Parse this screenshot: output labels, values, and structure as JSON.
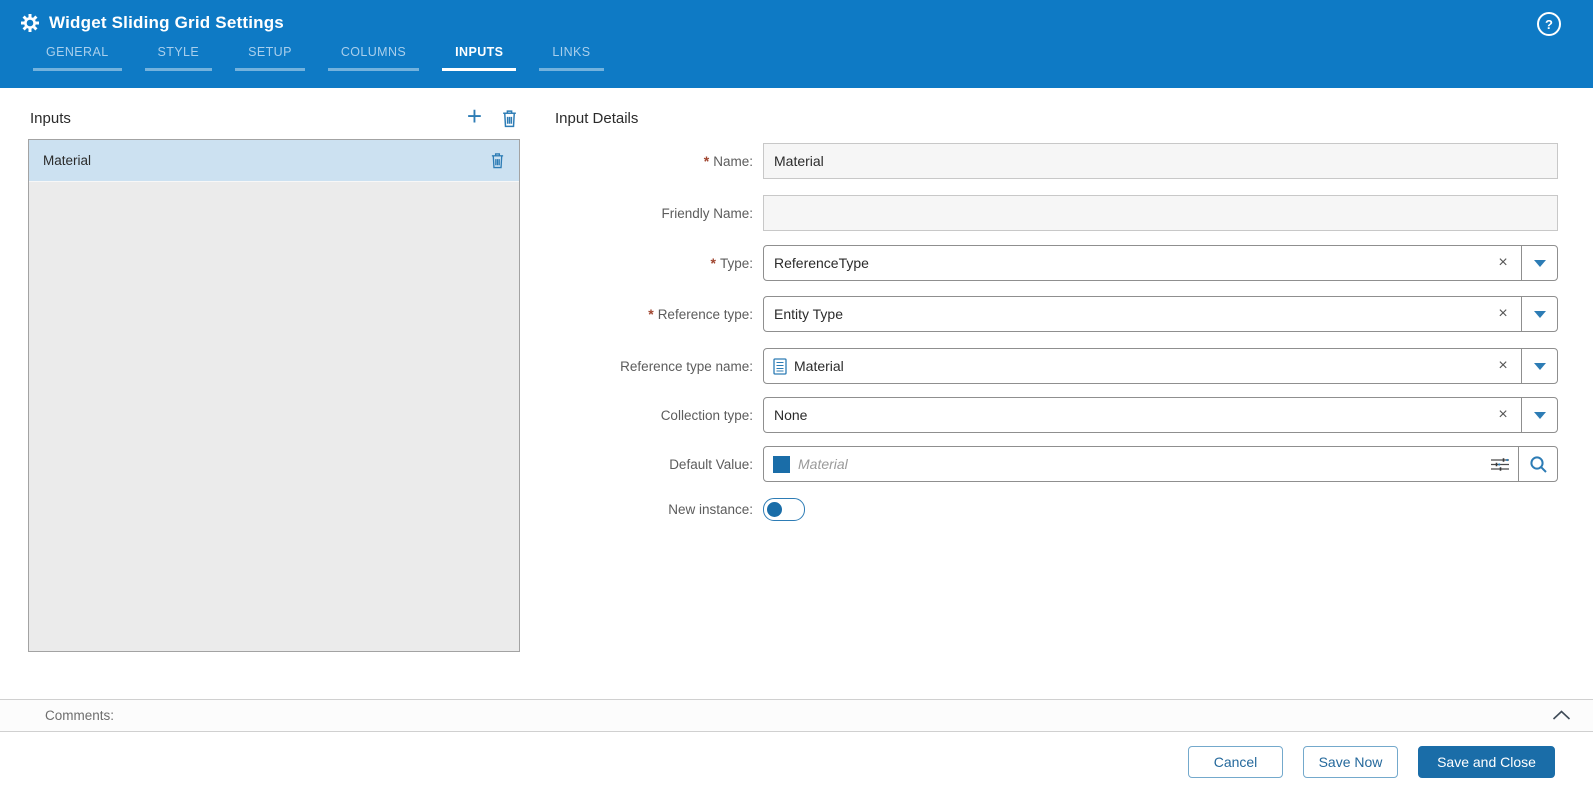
{
  "header": {
    "title": "Widget Sliding Grid Settings",
    "help_glyph": "?",
    "tabs": [
      {
        "label": "GENERAL",
        "active": false
      },
      {
        "label": "STYLE",
        "active": false
      },
      {
        "label": "SETUP",
        "active": false
      },
      {
        "label": "COLUMNS",
        "active": false
      },
      {
        "label": "INPUTS",
        "active": true
      },
      {
        "label": "LINKS",
        "active": false
      }
    ]
  },
  "inputs_panel": {
    "title": "Inputs",
    "add_glyph": "+",
    "items": [
      {
        "label": "Material",
        "selected": true
      }
    ]
  },
  "details": {
    "title": "Input Details",
    "required_mark": "*",
    "combo_clear_glyph": "×",
    "fields": [
      {
        "label": "Name:",
        "required": true,
        "widget": "text",
        "value": "Material"
      },
      {
        "label": "Friendly Name:",
        "required": false,
        "widget": "text",
        "value": ""
      },
      {
        "label": "Type:",
        "required": true,
        "widget": "combo",
        "value": "ReferenceType"
      },
      {
        "label": "Reference type:",
        "required": true,
        "widget": "combo",
        "value": "Entity Type"
      },
      {
        "label": "Reference type name:",
        "required": false,
        "widget": "combo",
        "value": "Material",
        "icon": "document-icon"
      },
      {
        "label": "Collection type:",
        "required": false,
        "widget": "combo",
        "value": "None"
      },
      {
        "label": "Default Value:",
        "required": false,
        "widget": "lookup",
        "value": "",
        "placeholder": "Material"
      },
      {
        "label": "New instance:",
        "required": false,
        "widget": "toggle",
        "value": false
      }
    ]
  },
  "comments": {
    "label": "Comments:"
  },
  "footer": {
    "buttons": [
      {
        "label": "Cancel",
        "style": "outline"
      },
      {
        "label": "Save Now",
        "style": "outline"
      },
      {
        "label": "Save and Close",
        "style": "primary"
      }
    ]
  },
  "colors": {
    "header_blue": "#0e7ac5",
    "accent_blue": "#2d7cb5",
    "primary_button": "#1a6da8",
    "selected_item_bg": "#cce1f1",
    "required_mark": "#a0452f"
  }
}
